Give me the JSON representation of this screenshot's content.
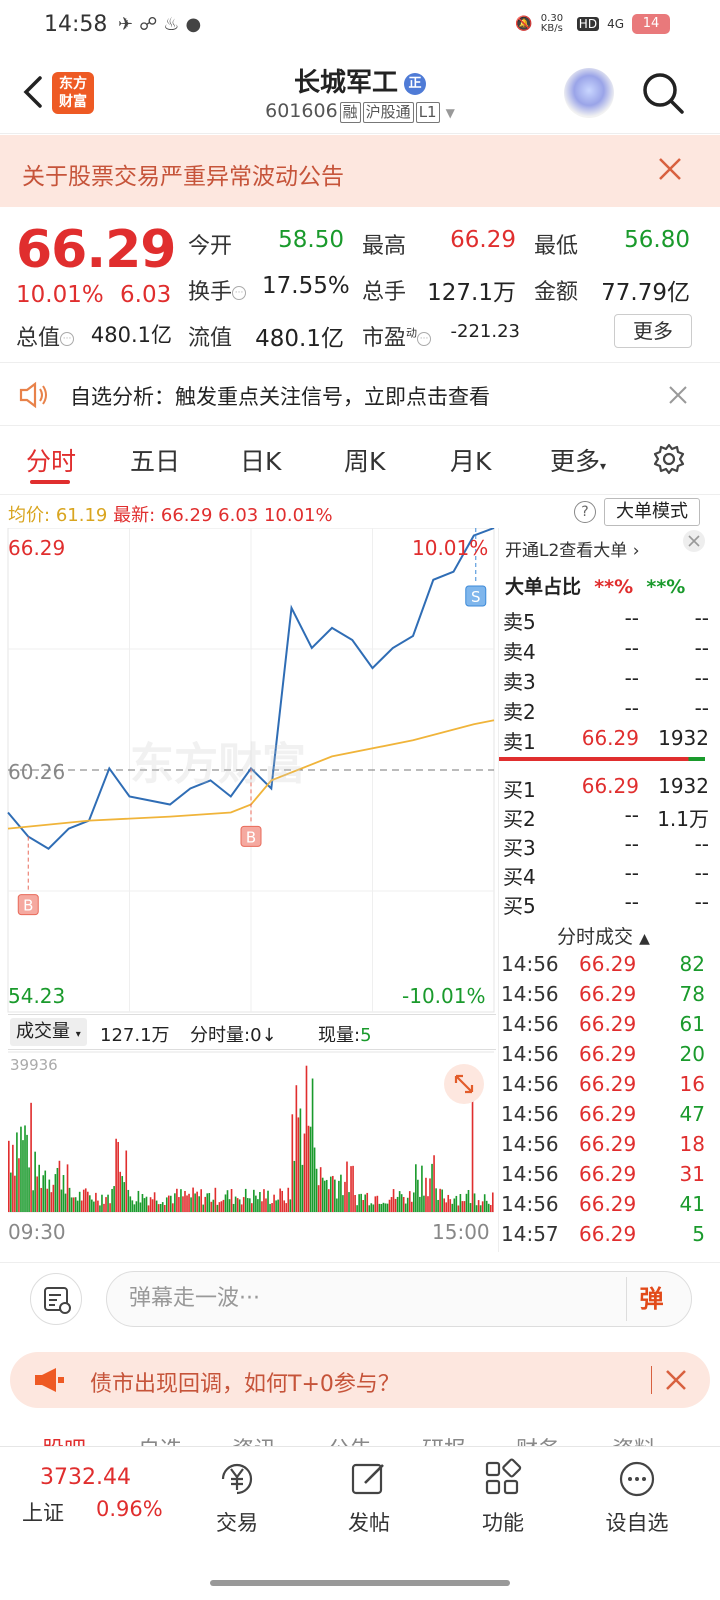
{
  "status_bar": {
    "time": "14:58",
    "net_speed": "0.30\nKB/s",
    "hd": "HD",
    "signal": "4G",
    "battery": "14"
  },
  "header": {
    "title": "长城军工",
    "title_badge": "正",
    "code": "601606",
    "tags": [
      "融",
      "沪股通",
      "L1"
    ],
    "logo_text": "东方财富"
  },
  "notice": {
    "text": "关于股票交易严重异常波动公告"
  },
  "quote": {
    "price": "66.29",
    "pct": "10.01%",
    "change": "6.03",
    "rows": [
      [
        {
          "label": "今开",
          "value": "58.50",
          "color": "green"
        },
        {
          "label": "最高",
          "value": "66.29",
          "color": "red"
        },
        {
          "label": "最低",
          "value": "56.80",
          "color": "green"
        }
      ],
      [
        {
          "label": "换手",
          "value": "17.55%",
          "color": "black"
        },
        {
          "label": "总手",
          "value": "127.1万",
          "color": "black"
        },
        {
          "label": "金额",
          "value": "77.79亿",
          "color": "black"
        }
      ],
      [
        {
          "label": "总值",
          "value": "480.1亿",
          "color": "black"
        },
        {
          "label": "流值",
          "value": "480.1亿",
          "color": "black"
        },
        {
          "label": "市盈",
          "value": "-221.23",
          "color": "black",
          "sup": "动"
        }
      ]
    ],
    "more_label": "更多"
  },
  "analysis": {
    "text": "自选分析：触发重点关注信号，立即点击查看"
  },
  "tabs": [
    "分时",
    "五日",
    "日K",
    "周K",
    "月K",
    "更多"
  ],
  "avg_row": {
    "avg_label": "均价:",
    "avg_value": "61.19",
    "latest_label": "最新:",
    "latest_price": "66.29",
    "latest_change": "6.03",
    "latest_pct": "10.01%",
    "big_order_mode": "大单模式"
  },
  "chart": {
    "top_price": "66.29",
    "top_pct": "10.01%",
    "mid_price": "60.26",
    "bottom_price": "54.23",
    "bottom_pct": "-10.01%",
    "watermark": "东方财富",
    "markers": [
      {
        "label": "B"
      },
      {
        "label": "B"
      },
      {
        "label": "S"
      }
    ],
    "volume_select": "成交量",
    "volume_total": "127.1万",
    "minute_volume": "分时量:0↓",
    "current_volume_label": "现量:",
    "current_volume_value": "5",
    "vol_max": "39936",
    "start_time": "09:30",
    "end_time": "15:00"
  },
  "chart_data": {
    "type": "line",
    "title": "",
    "ylim": [
      54.23,
      66.29
    ],
    "series": [
      {
        "x": [
          0,
          10,
          20,
          30,
          40,
          50,
          60,
          70,
          80,
          90,
          100,
          110,
          120,
          130,
          140,
          150,
          160,
          170,
          180,
          190,
          200,
          210,
          220,
          230,
          240
        ],
        "values": [
          59.2,
          58.6,
          58.3,
          58.8,
          59.0,
          60.3,
          59.6,
          59.5,
          59.4,
          59.8,
          60.0,
          59.6,
          60.3,
          59.8,
          64.3,
          63.3,
          63.8,
          63.5,
          62.8,
          63.3,
          63.6,
          65.0,
          65.2,
          66.1,
          66.29
        ]
      },
      {
        "name": "均价",
        "x": [
          0,
          40,
          80,
          110,
          120,
          130,
          160,
          200,
          230,
          240
        ],
        "values": [
          58.8,
          59.0,
          59.1,
          59.2,
          59.4,
          60.0,
          60.6,
          61.0,
          61.4,
          61.5
        ]
      }
    ]
  },
  "order_book": {
    "header": "开通L2查看大单",
    "ratio_label": "大单占比",
    "ratio_buy": "**%",
    "ratio_sell": "**%",
    "asks": [
      {
        "name": "卖5",
        "price": "--",
        "vol": "--"
      },
      {
        "name": "卖4",
        "price": "--",
        "vol": "--"
      },
      {
        "name": "卖3",
        "price": "--",
        "vol": "--"
      },
      {
        "name": "卖2",
        "price": "--",
        "vol": "--"
      },
      {
        "name": "卖1",
        "price": "66.29",
        "vol": "1932"
      }
    ],
    "bids": [
      {
        "name": "买1",
        "price": "66.29",
        "vol": "1932"
      },
      {
        "name": "买2",
        "price": "--",
        "vol": "1.1万"
      },
      {
        "name": "买3",
        "price": "--",
        "vol": "--"
      },
      {
        "name": "买4",
        "price": "--",
        "vol": "--"
      },
      {
        "name": "买5",
        "price": "--",
        "vol": "--"
      }
    ],
    "trades_header": "分时成交",
    "trades": [
      {
        "time": "14:56",
        "price": "66.29",
        "vol": "82",
        "color": "green"
      },
      {
        "time": "14:56",
        "price": "66.29",
        "vol": "78",
        "color": "green"
      },
      {
        "time": "14:56",
        "price": "66.29",
        "vol": "61",
        "color": "green"
      },
      {
        "time": "14:56",
        "price": "66.29",
        "vol": "20",
        "color": "green"
      },
      {
        "time": "14:56",
        "price": "66.29",
        "vol": "16",
        "color": "red"
      },
      {
        "time": "14:56",
        "price": "66.29",
        "vol": "47",
        "color": "green"
      },
      {
        "time": "14:56",
        "price": "66.29",
        "vol": "18",
        "color": "red"
      },
      {
        "time": "14:56",
        "price": "66.29",
        "vol": "31",
        "color": "red"
      },
      {
        "time": "14:56",
        "price": "66.29",
        "vol": "41",
        "color": "green"
      },
      {
        "time": "14:57",
        "price": "66.29",
        "vol": "5",
        "color": "green"
      }
    ]
  },
  "comment": {
    "placeholder": "弹幕走一波···",
    "button": "弹"
  },
  "promo": {
    "text": "债市出现回调，如何T+0参与？"
  },
  "peek_tabs": [
    "股吧",
    "自选",
    "资讯",
    "公告",
    "研报",
    "财务",
    "资料"
  ],
  "navbar": {
    "index_price": "3732.44",
    "index_name": "上证",
    "index_pct": "0.96%",
    "items": [
      {
        "label": "交易",
        "icon": "yen-icon"
      },
      {
        "label": "发帖",
        "icon": "edit-icon"
      },
      {
        "label": "功能",
        "icon": "grid-icon"
      },
      {
        "label": "设自选",
        "icon": "more-icon"
      }
    ]
  },
  "colors": {
    "up": "#e02e2e",
    "down": "#1a9a2c",
    "price_line": "#2f6db5",
    "avg_line": "#f0b43a",
    "accent": "#ee5a24"
  }
}
